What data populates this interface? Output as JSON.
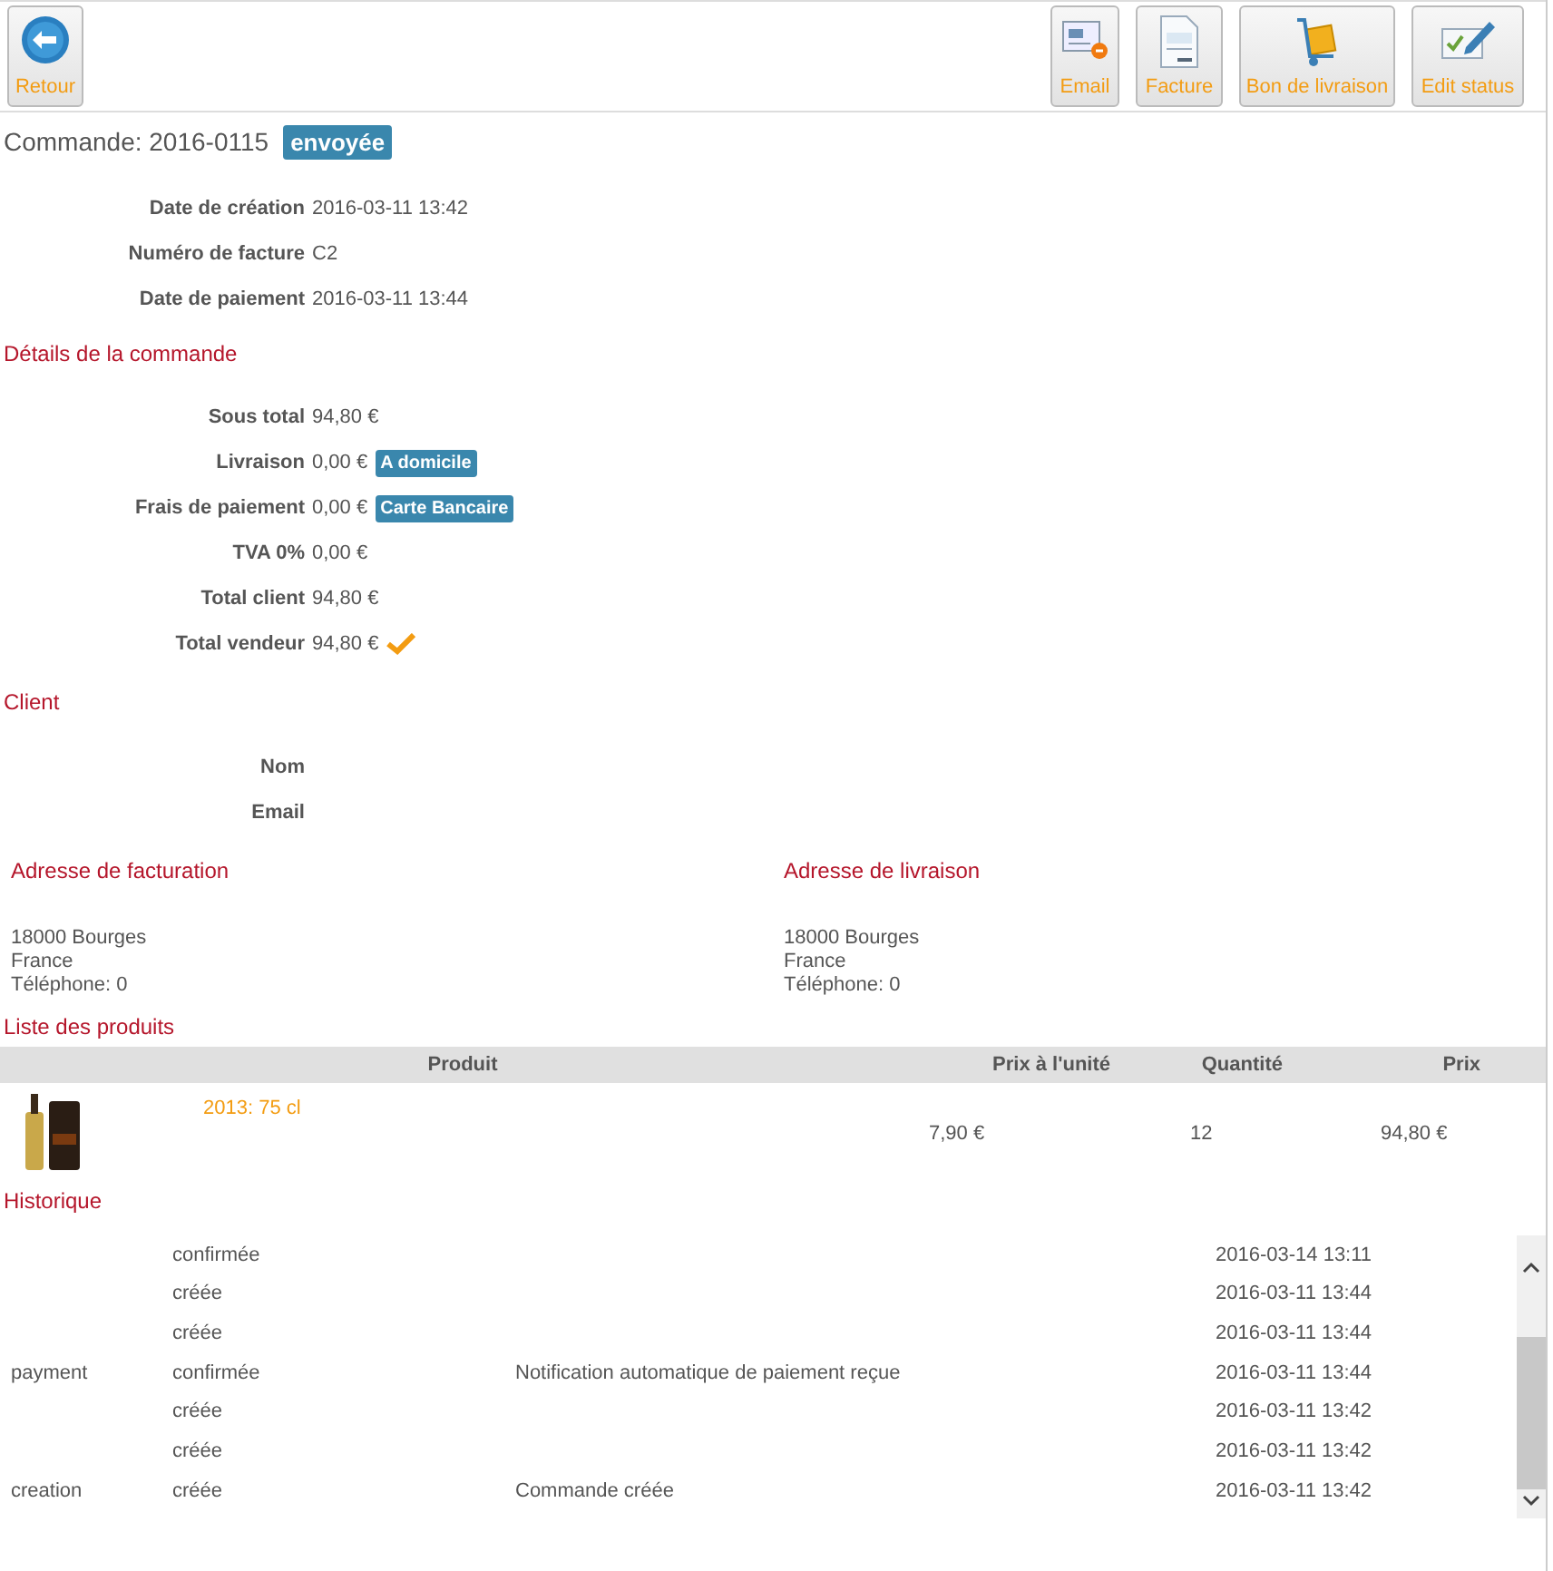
{
  "toolbar": {
    "back_button": {
      "label": "Retour"
    },
    "buttons": [
      {
        "kind": "email",
        "label": "Email"
      },
      {
        "kind": "invoice",
        "label": "Facture"
      },
      {
        "kind": "delivery",
        "label": "Bon de livraison"
      },
      {
        "kind": "status",
        "label": "Edit status"
      }
    ]
  },
  "order": {
    "title": "Commande: 2016-0115",
    "status_badge": "envoyée"
  },
  "info": [
    {
      "label": "Date de création",
      "value": "2016-03-11 13:42"
    },
    {
      "label": "Numéro de facture",
      "value": "C2"
    },
    {
      "label": "Date de paiement",
      "value": "2016-03-11 13:44"
    }
  ],
  "details": {
    "heading": "Détails de la commande",
    "rows": [
      {
        "label": "Sous total",
        "value": "94,80 €"
      },
      {
        "label": "Livraison",
        "value": "0,00 €",
        "badge": "A domicile"
      },
      {
        "label": "Frais de paiement",
        "value": "0,00 €",
        "badge": "Carte Bancaire"
      },
      {
        "label": "TVA 0%",
        "value": "0,00 €"
      },
      {
        "label": "Total client",
        "value": "94,80 €"
      },
      {
        "label": "Total vendeur",
        "value": "94,80 €",
        "checked": true
      }
    ]
  },
  "client": {
    "heading": "Client",
    "fields": [
      {
        "label": "Nom"
      },
      {
        "label": "Email"
      }
    ]
  },
  "addresses": [
    {
      "heading": "Adresse de facturation",
      "lines": [
        "18000 Bourges",
        "France",
        "Téléphone: 0"
      ]
    },
    {
      "heading": "Adresse de livraison",
      "lines": [
        "18000 Bourges",
        "France",
        "Téléphone: 0"
      ]
    }
  ],
  "products": {
    "heading": "Liste des produits",
    "columns": [
      "Produit",
      "Prix à l'unité",
      "Quantité",
      "Prix"
    ],
    "rows": [
      {
        "name": "2013: 75 cl",
        "unit_price": "7,90 €",
        "quantity": "12",
        "price": "94,80 €"
      }
    ]
  },
  "history": {
    "heading": "Historique",
    "rows": [
      {
        "type": "",
        "status": "confirmée",
        "message": "",
        "date": "2016-03-14 13:11"
      },
      {
        "type": "",
        "status": "créée",
        "message": "",
        "date": "2016-03-11 13:44"
      },
      {
        "type": "",
        "status": "créée",
        "message": "",
        "date": "2016-03-11 13:44"
      },
      {
        "type": "payment",
        "status": "confirmée",
        "message": "Notification automatique de paiement reçue",
        "date": "2016-03-11 13:44"
      },
      {
        "type": "",
        "status": "créée",
        "message": "",
        "date": "2016-03-11 13:42"
      },
      {
        "type": "",
        "status": "créée",
        "message": "",
        "date": "2016-03-11 13:42"
      },
      {
        "type": "creation",
        "status": "créée",
        "message": "Commande créée",
        "date": "2016-03-11 13:42"
      }
    ]
  }
}
